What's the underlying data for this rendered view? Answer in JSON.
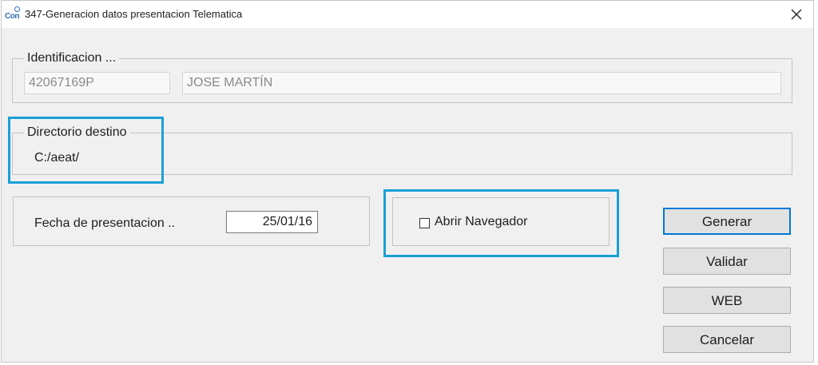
{
  "window": {
    "title": "347-Generacion datos presentacion Telematica",
    "icon": "con-app-icon",
    "icon_text": "Con"
  },
  "identificacion": {
    "legend": "Identificacion ...",
    "nif": "42067169P",
    "nombre": "JOSE MARTÍN"
  },
  "directorio": {
    "legend": "Directorio destino",
    "path": "C:/aeat/"
  },
  "fecha": {
    "label": "Fecha de presentacion ..",
    "value": "25/01/16"
  },
  "navegador": {
    "label": "Abrir Navegador",
    "checked": false
  },
  "buttons": {
    "generar": "Generar",
    "validar": "Validar",
    "web": "WEB",
    "cancelar": "Cancelar"
  },
  "colors": {
    "highlight": "#1a9fd6",
    "default_button_border": "#0078d7",
    "dialog_background": "#f0f0f0"
  }
}
